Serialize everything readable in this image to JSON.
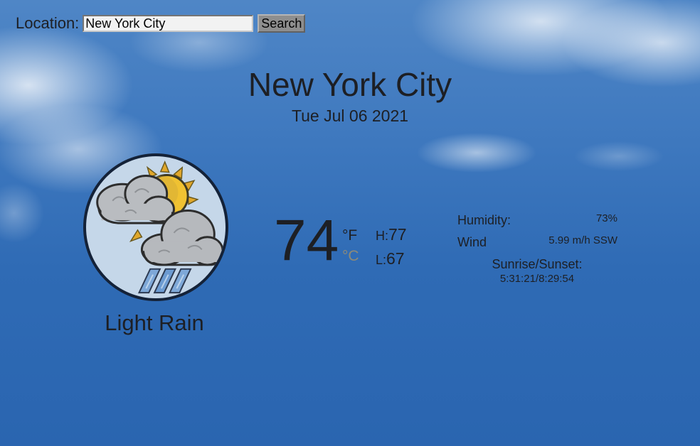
{
  "search": {
    "label": "Location:",
    "value": "New York City",
    "button_label": "Search"
  },
  "header": {
    "city": "New York City",
    "date": "Tue Jul 06 2021"
  },
  "current": {
    "icon": "sun-cloud-rain-icon",
    "condition": "Light Rain",
    "temperature": "74",
    "unit_f": "°F",
    "unit_c": "°C",
    "high_label": "H:",
    "high_value": "77",
    "low_label": "L:",
    "low_value": "67"
  },
  "details": {
    "humidity_label": "Humidity:",
    "humidity_value": "73%",
    "wind_label": "Wind",
    "wind_value": "5.99 m/h SSW",
    "sun_label": "Sunrise/Sunset:",
    "sun_value": "5:31:21/8:29:54"
  },
  "colors": {
    "sky": "#2f6bb5",
    "text": "#1d1f24",
    "inactive_unit": "#8d8a79",
    "icon_border": "#142238",
    "sun": "#e8b32a"
  }
}
